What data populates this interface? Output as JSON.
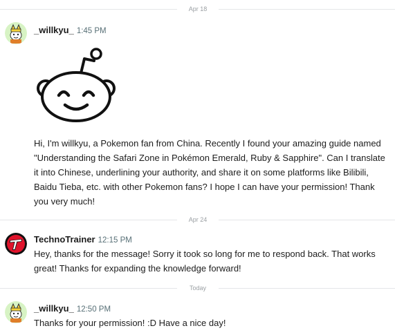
{
  "chat": {
    "dividers": [
      "Apr 18",
      "Apr 24",
      "Today"
    ],
    "messages": [
      {
        "user": "_willkyu_",
        "time": "1:45 PM",
        "avatar_icon": "snoo-avatar-icon",
        "image_icon": "reddit-snoo-image",
        "text": "Hi, I'm willkyu, a Pokemon fan from China. Recently I found your amazing guide named \"Understanding the Safari Zone in Pokémon Emerald, Ruby & Sapphire\". Can I translate it into Chinese, underlining your authority, and share it on some platforms like Bilibili, Baidu Tieba, etc. with other Pokemon fans? I hope I can have your permission! Thank you very much!"
      },
      {
        "user": "TechnoTrainer",
        "time": "12:15 PM",
        "avatar_icon": "red-t-logo-icon",
        "text": "Hey, thanks for the message! Sorry it took so long for me to respond back. That works great! Thanks for expanding the knowledge forward!"
      },
      {
        "user": "_willkyu_",
        "time": "12:50 PM",
        "avatar_icon": "snoo-avatar-icon",
        "text": "Thanks for your permission! :D Have a nice day!"
      }
    ]
  },
  "colors": {
    "divider_line": "#e4e6e8",
    "divider_text": "#9a9fa3",
    "timestamp": "#576f76",
    "avatar_bg": "#d7f3c4",
    "techno_red": "#e0142c"
  }
}
